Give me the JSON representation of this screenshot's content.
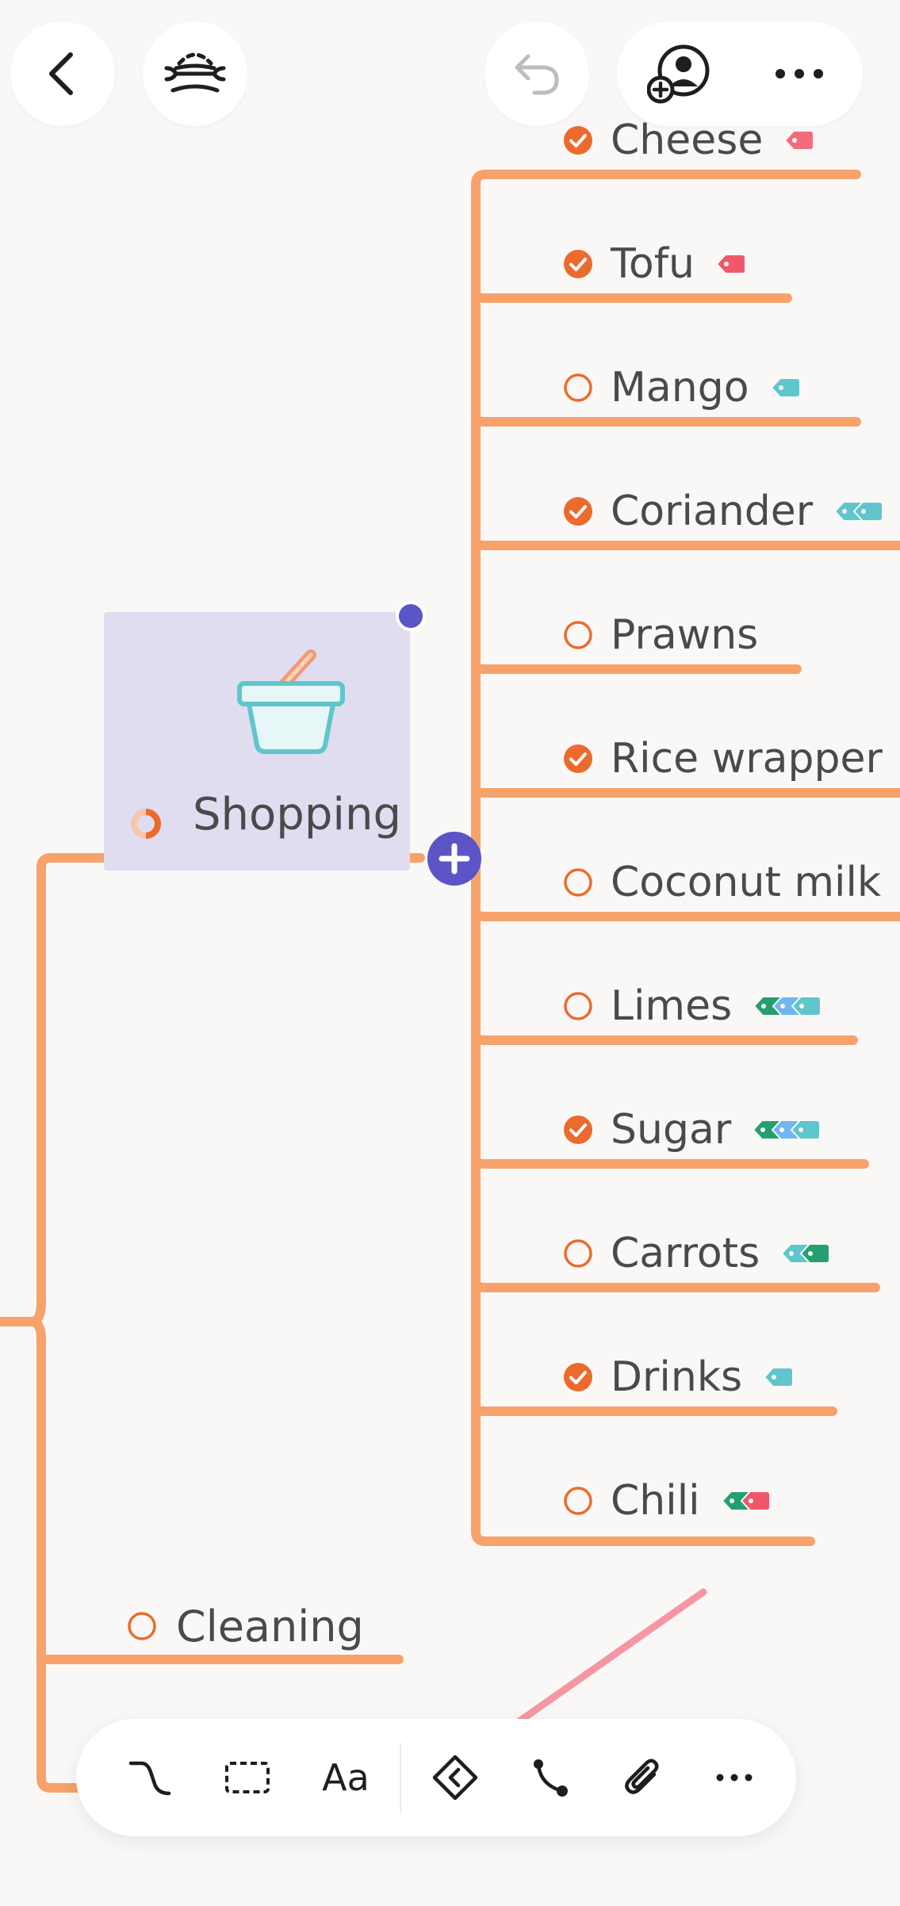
{
  "mindmap": {
    "topic": {
      "label": "Shopping",
      "icon": "basket-icon"
    },
    "items": [
      {
        "label": "Cheese",
        "checked": true,
        "tags": [
          "#f26b7a"
        ]
      },
      {
        "label": "Tofu",
        "checked": true,
        "tags": [
          "#f0586a"
        ]
      },
      {
        "label": "Mango",
        "checked": false,
        "tags": [
          "#5ec6cc"
        ]
      },
      {
        "label": "Coriander",
        "checked": true,
        "tags": [
          "#5ec6cc",
          "#5ec6cc"
        ]
      },
      {
        "label": "Prawns",
        "checked": false,
        "tags": []
      },
      {
        "label": "Rice wrapper",
        "checked": true,
        "tags": []
      },
      {
        "label": "Coconut milk",
        "checked": false,
        "tags": []
      },
      {
        "label": "Limes",
        "checked": false,
        "tags": [
          "#23a06e",
          "#6fb7ee",
          "#5ec6cc"
        ]
      },
      {
        "label": "Sugar",
        "checked": true,
        "tags": [
          "#23a06e",
          "#6fb7ee",
          "#5ec6cc"
        ]
      },
      {
        "label": "Carrots",
        "checked": false,
        "tags": [
          "#5ec6cc",
          "#23a06e"
        ]
      },
      {
        "label": "Drinks",
        "checked": true,
        "tags": [
          "#5ec6cc"
        ]
      },
      {
        "label": "Chili",
        "checked": false,
        "tags": [
          "#23a06e",
          "#f0586a"
        ]
      }
    ],
    "sibling": {
      "label": "Cleaning",
      "checked": false
    }
  },
  "colors": {
    "branch": "#f6a26a",
    "check": "#ec6a2c",
    "accent": "#5b55c7",
    "topic_bg": "#e0ddf0",
    "arrow": "#f497a3"
  },
  "toolbar": {
    "items": [
      {
        "name": "connector-icon"
      },
      {
        "name": "boundary-icon"
      },
      {
        "name": "text-style",
        "label": "Aa"
      },
      {
        "name": "collapse-icon"
      },
      {
        "name": "relationship-icon"
      },
      {
        "name": "attachment-icon"
      },
      {
        "name": "more-icon"
      }
    ]
  },
  "header": {
    "icons": [
      "back-icon",
      "outline-icon",
      "undo-icon",
      "add-collaborator-icon",
      "more-icon"
    ]
  }
}
